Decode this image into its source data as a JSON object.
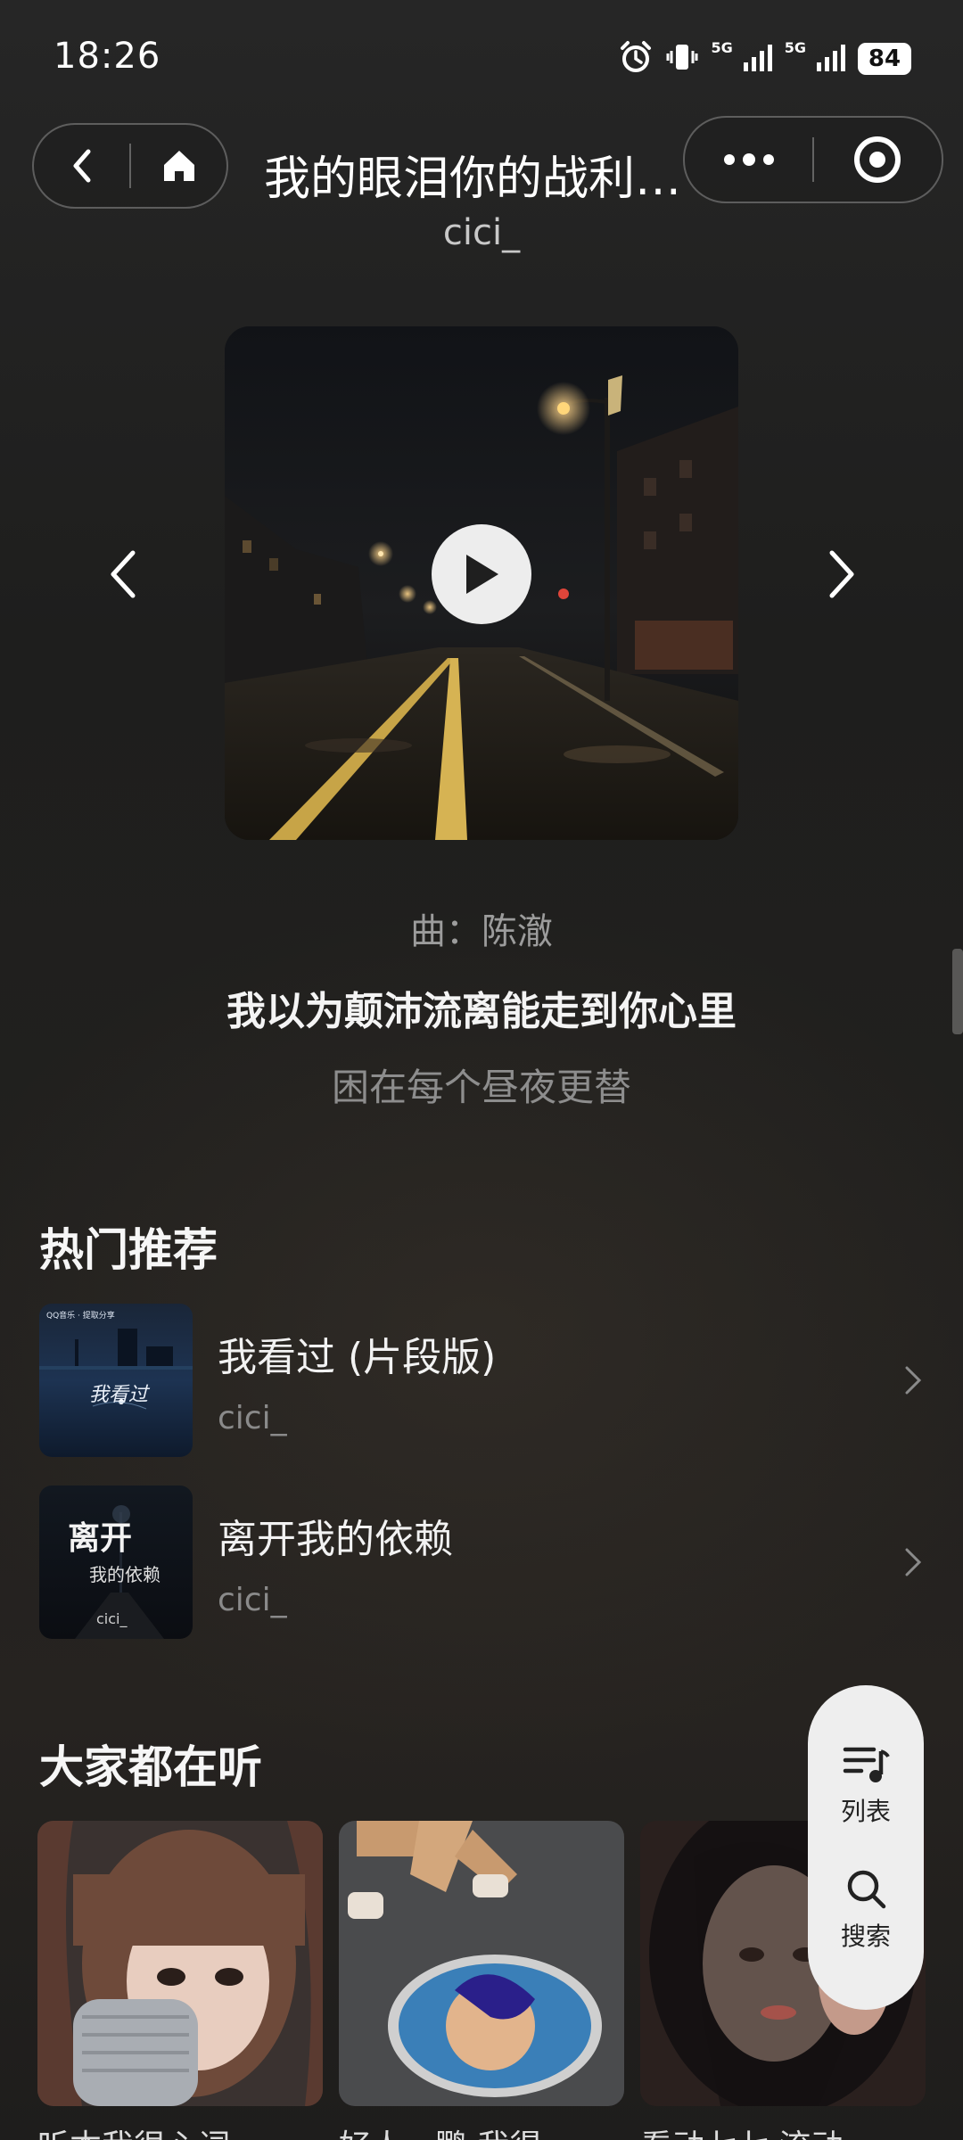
{
  "status_bar": {
    "time": "18:26",
    "network_1": "5G",
    "network_2": "5G",
    "battery": "84"
  },
  "header": {
    "title": "我的眼泪你的战利…",
    "artist": "cici_"
  },
  "player": {
    "composer": "曲：陈澈",
    "lyric_current": "我以为颠沛流离能走到你心里",
    "lyric_next": "困在每个昼夜更替"
  },
  "hot": {
    "section_title": "热门推荐",
    "items": [
      {
        "title": "我看过 (片段版)",
        "artist": "cici_",
        "cover_text": "我看过",
        "cover_badge": "QQ音乐 · 提取分享"
      },
      {
        "title": "离开我的依赖",
        "artist": "cici_",
        "cover_text_1": "离开",
        "cover_text_2": "我的依赖",
        "cover_text_3": "cici_"
      }
    ]
  },
  "popular": {
    "section_title": "大家都在听",
    "cards_bottom_text": [
      "听本我很心词…",
      "好人一鹏 我得…",
      "看动七七 流动…"
    ]
  },
  "float_panel": {
    "list_label": "列表",
    "search_label": "搜索"
  },
  "colors": {
    "background": "#1e1e1d",
    "panel": "#eeeeee",
    "lyric_dim": "#8d8d8d"
  }
}
